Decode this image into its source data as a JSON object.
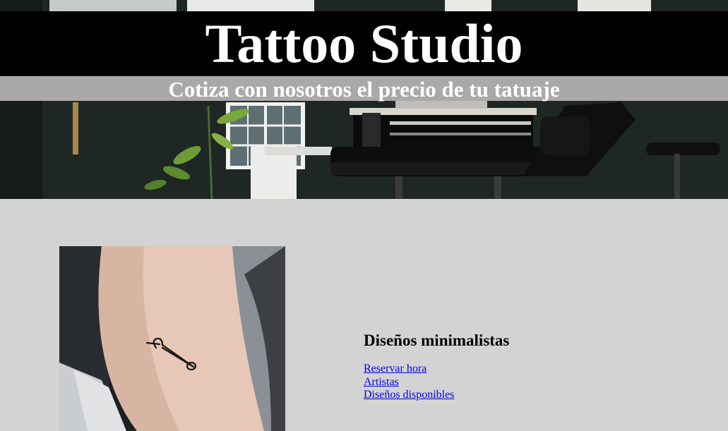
{
  "header": {
    "title": "Tattoo Studio",
    "subtitle": "Cotiza con nosotros el precio de tu tatuaje"
  },
  "feature": {
    "heading": "Diseños minimalistas",
    "links": [
      {
        "label": "Reservar hora"
      },
      {
        "label": "Artistas"
      },
      {
        "label": "Diseños disponibles"
      }
    ]
  },
  "colors": {
    "page_background": "#d3d3d3",
    "title_band": "#000000",
    "subtitle_band": "#a9a9a9",
    "link": "#0000ee"
  },
  "images": {
    "hero": "tattoo-studio-interior-photo",
    "feature": "safety-pin-tattoo-photo"
  }
}
